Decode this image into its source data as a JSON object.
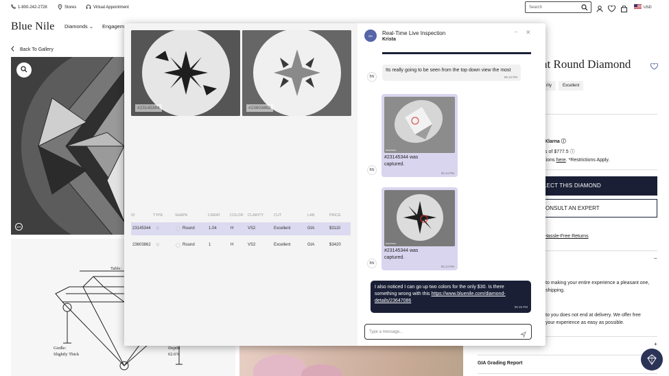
{
  "topbar": {
    "phone": "1-800-242-2728",
    "stores": "Stores",
    "virtual": "Virtual Appointment",
    "search_placeholder": "Search",
    "currency": "USD"
  },
  "nav": {
    "logo": "Blue Nile",
    "diamonds": "Diamonds",
    "engagement": "Engagem"
  },
  "gallery": {
    "back_label": "Back To Gallery",
    "badge_360": "360",
    "diagram_table": "Table:",
    "diagram_girdle_label": "Girdle:",
    "diagram_girdle_value": "Slightly Thick",
    "diagram_depth_label": "Depth:",
    "diagram_depth_value": "62.6%"
  },
  "product": {
    "title": "at Round Diamond",
    "tag_clarity": "rity",
    "tag_cut": "Excellent",
    "klarna": "Klarna",
    "klarna_price": "s of $777.5",
    "options_prefix": "ptions",
    "options_link": "here",
    "options_suffix": "*Restrictions Apply.",
    "select_button": "LECT THIS DIAMOND",
    "consult_button": "ONSULT AN EXPERT",
    "returns": "Hassle-Free Returns",
    "text1_line1": "to making your entire experience a pleasant one,",
    "text1_line2": "shipping.",
    "text2_line1": "to you does not end at delivery. We offer free",
    "text2_line2": "your experience as easy as possible.",
    "product_details": "Product Details",
    "gia_report": "GIA Grading Report"
  },
  "compare": {
    "thumbs": [
      {
        "id": "#23145344"
      },
      {
        "id": "#23603862"
      }
    ],
    "headers": [
      "ID",
      "TYPE",
      "SHAPE",
      "CARAT",
      "COLOR",
      "CLARITY",
      "CUT",
      "LAB",
      "PRICE"
    ],
    "rows": [
      {
        "id": "23145344",
        "shape": "Round",
        "carat": "1.04",
        "color": "H",
        "clarity": "VS2",
        "cut": "Excellent",
        "lab": "GIA",
        "price": "$3110"
      },
      {
        "id": "23603862",
        "shape": "Round",
        "carat": "1",
        "color": "H",
        "clarity": "VS2",
        "cut": "Excellent",
        "lab": "GIA",
        "price": "$3420"
      }
    ]
  },
  "chat": {
    "title": "Real-Time Live Inspection",
    "agent": "Krista",
    "avatar_initials": "BN",
    "sender_initials": "BN",
    "messages": [
      {
        "text": "Its really going to be seen from the top down view the most",
        "time": "05:13 PM"
      },
      {
        "caption1": "#23145344 was",
        "caption2": "captured.",
        "stamp": "#23145344",
        "time": "05:13 PM"
      },
      {
        "caption1": "#23145344 was",
        "caption2": "captured.",
        "stamp": "#23145344",
        "time": "05:13 PM"
      },
      {
        "text_line1": "I also noticed I can go up two colors for the only $30. Is there",
        "text_line2": "something wrong with this",
        "link1": "https://www.bluenile.com/diamond-",
        "link2": "details/23647086",
        "time": "05:15 PM"
      }
    ],
    "input_placeholder": "Type a message..."
  }
}
